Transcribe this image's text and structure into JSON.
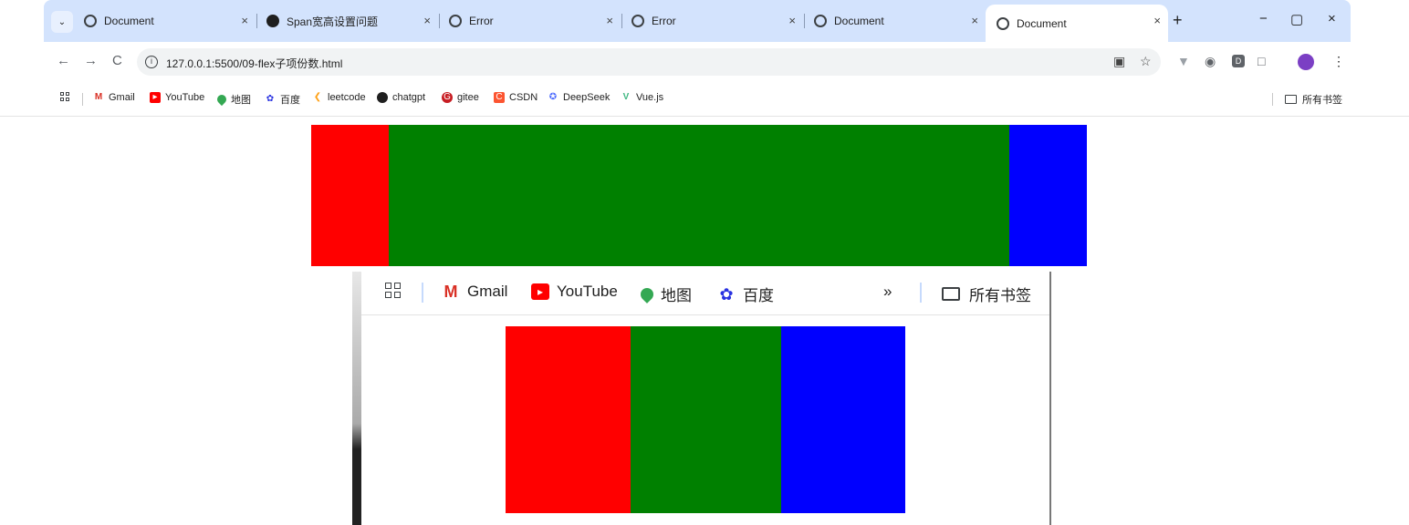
{
  "tabs": [
    {
      "title": "Document",
      "favicon": "globe-icon"
    },
    {
      "title": "Span宽高设置问题",
      "favicon": "openai-icon"
    },
    {
      "title": "Error",
      "favicon": "globe-icon"
    },
    {
      "title": "Error",
      "favicon": "globe-icon"
    },
    {
      "title": "Document",
      "favicon": "globe-icon"
    },
    {
      "title": "Document",
      "favicon": "globe-icon",
      "active": true
    }
  ],
  "tab_close_glyph": "×",
  "new_tab_glyph": "+",
  "window_controls": {
    "minimize": "−",
    "restore": "▢",
    "close": "×"
  },
  "address": {
    "url": "127.0.0.1:5500/09-flex子项份数.html"
  },
  "nav": {
    "back": "←",
    "forward": "→",
    "reload": "C"
  },
  "bookmarks": {
    "items": [
      {
        "label": "Gmail",
        "icon": "gmail-icon"
      },
      {
        "label": "YouTube",
        "icon": "youtube-icon"
      },
      {
        "label": "地图",
        "icon": "maps-icon"
      },
      {
        "label": "百度",
        "icon": "baidu-icon"
      },
      {
        "label": "leetcode",
        "icon": "leetcode-icon"
      },
      {
        "label": "chatgpt",
        "icon": "chatgpt-icon"
      },
      {
        "label": "gitee",
        "icon": "gitee-icon"
      },
      {
        "label": "CSDN",
        "icon": "csdn-icon"
      },
      {
        "label": "DeepSeek",
        "icon": "deepseek-icon"
      },
      {
        "label": "Vue.js",
        "icon": "vue-icon"
      }
    ],
    "all_bookmarks": "所有书签"
  },
  "page": {
    "flex_large": {
      "colors": [
        "#ff0000",
        "#008000",
        "#0000ff"
      ],
      "flex": [
        1,
        8,
        1
      ]
    },
    "inner_screenshot": {
      "bookmarks": [
        {
          "label": "Gmail",
          "icon": "gmail-icon"
        },
        {
          "label": "YouTube",
          "icon": "youtube-icon"
        },
        {
          "label": "地图",
          "icon": "maps-icon"
        },
        {
          "label": "百度",
          "icon": "baidu-icon"
        }
      ],
      "overflow": "»",
      "all_bookmarks": "所有书签",
      "flex_small": {
        "colors": [
          "#ff0000",
          "#008000",
          "#0000ff"
        ]
      }
    }
  }
}
